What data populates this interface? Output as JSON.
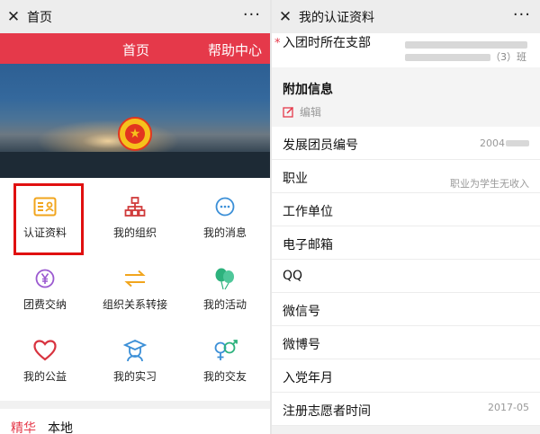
{
  "left": {
    "window_title": "首页",
    "close_icon": "✕",
    "more_icon": "···",
    "nav": {
      "home": "首页",
      "help": "帮助中心"
    },
    "menu": [
      {
        "label": "认证资料",
        "icon": "id-card-icon",
        "color": "#f1a51d"
      },
      {
        "label": "我的组织",
        "icon": "org-chart-icon",
        "color": "#d03a3a"
      },
      {
        "label": "我的消息",
        "icon": "message-icon",
        "color": "#3b8fd7"
      },
      {
        "label": "团费交纳",
        "icon": "yen-coin-icon",
        "color": "#9b59d0"
      },
      {
        "label": "组织关系转接",
        "icon": "transfer-arrows-icon",
        "color": "#f1a51d"
      },
      {
        "label": "我的活动",
        "icon": "balloons-icon",
        "color": "#2db27d"
      },
      {
        "label": "我的公益",
        "icon": "heart-icon",
        "color": "#d8333f"
      },
      {
        "label": "我的实习",
        "icon": "graduate-icon",
        "color": "#3b8fd7"
      },
      {
        "label": "我的交友",
        "icon": "gender-icon",
        "color": "#3b8fd7"
      }
    ],
    "tabs": {
      "featured": "精华",
      "local": "本地"
    },
    "colors": {
      "brand_red": "#e5394a"
    }
  },
  "right": {
    "window_title": "我的认证资料",
    "close_icon": "✕",
    "more_icon": "···",
    "branch_label": "入团时所在支部",
    "branch_value_tail": "（3）班",
    "additional_info": {
      "title": "附加信息",
      "edit": "编辑"
    },
    "fields": [
      {
        "label": "发展团员编号",
        "value": "2004"
      },
      {
        "label": "职业",
        "value": "职业为学生无收入"
      },
      {
        "label": "工作单位",
        "value": ""
      },
      {
        "label": "电子邮箱",
        "value": ""
      },
      {
        "label": "QQ",
        "value": ""
      },
      {
        "label": "微信号",
        "value": ""
      },
      {
        "label": "微博号",
        "value": ""
      },
      {
        "label": "入党年月",
        "value": ""
      },
      {
        "label": "注册志愿者时间",
        "value": "2017-05"
      }
    ]
  }
}
